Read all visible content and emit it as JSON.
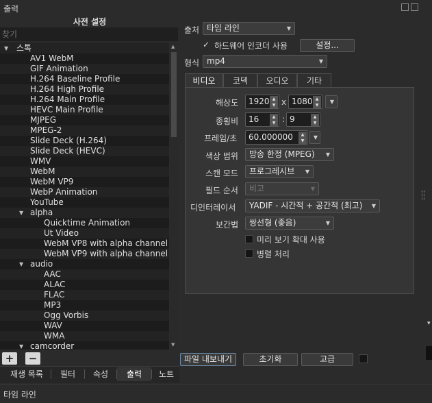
{
  "window": {
    "title": "출력"
  },
  "presets": {
    "heading": "사전 설정",
    "search_placeholder": "찾기",
    "tree": [
      {
        "label": "스톡",
        "level": 0,
        "expanded": true
      },
      {
        "label": "AV1 WebM",
        "level": 1
      },
      {
        "label": "GIF Animation",
        "level": 1
      },
      {
        "label": "H.264 Baseline Profile",
        "level": 1
      },
      {
        "label": "H.264 High Profile",
        "level": 1
      },
      {
        "label": "H.264 Main Profile",
        "level": 1
      },
      {
        "label": "HEVC Main Profile",
        "level": 1
      },
      {
        "label": "MJPEG",
        "level": 1
      },
      {
        "label": "MPEG-2",
        "level": 1
      },
      {
        "label": "Slide Deck (H.264)",
        "level": 1
      },
      {
        "label": "Slide Deck (HEVC)",
        "level": 1
      },
      {
        "label": "WMV",
        "level": 1
      },
      {
        "label": "WebM",
        "level": 1
      },
      {
        "label": "WebM VP9",
        "level": 1
      },
      {
        "label": "WebP Animation",
        "level": 1
      },
      {
        "label": "YouTube",
        "level": 1
      },
      {
        "label": "alpha",
        "level": 1,
        "expanded": true
      },
      {
        "label": "Quicktime Animation",
        "level": 2
      },
      {
        "label": "Ut Video",
        "level": 2
      },
      {
        "label": "WebM VP8 with alpha channel",
        "level": 2
      },
      {
        "label": "WebM VP9 with alpha channel",
        "level": 2
      },
      {
        "label": "audio",
        "level": 1,
        "expanded": true
      },
      {
        "label": "AAC",
        "level": 2
      },
      {
        "label": "ALAC",
        "level": 2
      },
      {
        "label": "FLAC",
        "level": 2
      },
      {
        "label": "MP3",
        "level": 2
      },
      {
        "label": "Ogg Vorbis",
        "level": 2
      },
      {
        "label": "WAV",
        "level": 2
      },
      {
        "label": "WMA",
        "level": 2
      },
      {
        "label": "camcorder",
        "level": 1,
        "expanded": true
      }
    ],
    "add_icon": "plus-icon",
    "remove_icon": "minus-icon"
  },
  "output": {
    "source_label": "출처",
    "source_value": "타임 라인",
    "hw_encoder_label": "하드웨어 인코더 사용",
    "hw_encoder_checked": true,
    "settings_button": "설정...",
    "format_label": "형식",
    "format_value": "mp4"
  },
  "tabs": [
    "비디오",
    "코덱",
    "오디오",
    "기타"
  ],
  "active_tab": 0,
  "video": {
    "resolution_label": "해상도",
    "width": "1920",
    "times": "x",
    "height": "1080",
    "aspect_label": "종횡비",
    "aspect_w": "16",
    "colon": ":",
    "aspect_h": "9",
    "fps_label": "프레임/초",
    "fps": "60.000000",
    "color_range_label": "색상 범위",
    "color_range": "방송 한정 (MPEG)",
    "scan_mode_label": "스캔 모드",
    "scan_mode": "프로그레시브",
    "field_order_label": "필드 순서",
    "field_order": "비고",
    "deinterlacer_label": "디인터레이서",
    "deinterlacer": "YADIF - 시간적 + 공간적 (최고)",
    "interpolation_label": "보간법",
    "interpolation": "쌍선형 (좋음)",
    "preview_scale_label": "미리 보기 확대 사용",
    "parallel_label": "병렬 처리"
  },
  "actions": {
    "export_file": "파일 내보내기",
    "reset": "초기화",
    "advanced": "고급"
  },
  "bottom_tabs": [
    "재생 목록",
    "필터",
    "속성",
    "출력",
    "노트"
  ],
  "status": "타임 라인",
  "colors": {
    "background": "#2b2b2b",
    "panel": "#353535",
    "tree_alt_row": "#1c1c1c"
  }
}
